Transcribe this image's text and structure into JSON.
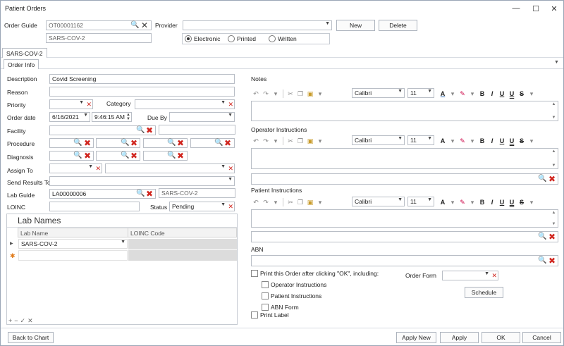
{
  "window": {
    "title": "Patient Orders"
  },
  "header": {
    "order_guide_label": "Order Guide",
    "order_guide_value": "OT00001162",
    "order_guide_name": "SARS-COV-2",
    "provider_label": "Provider",
    "provider_value": "",
    "new_label": "New",
    "delete_label": "Delete",
    "delivery": {
      "options": [
        "Electronic",
        "Printed",
        "Written"
      ],
      "selected": "Electronic"
    }
  },
  "tabs": {
    "outer": "SARS-COV-2",
    "inner": "Order Info"
  },
  "form": {
    "description_label": "Description",
    "description_value": "Covid Screening",
    "reason_label": "Reason",
    "reason_value": "",
    "priority_label": "Priority",
    "priority_value": "",
    "category_label": "Category",
    "category_value": "",
    "order_date_label": "Order date",
    "order_date_value": "6/16/2021",
    "order_time_value": "9:46:15 AM",
    "due_by_label": "Due By",
    "due_by_value": "",
    "facility_label": "Facility",
    "procedure_label": "Procedure",
    "diagnosis_label": "Diagnosis",
    "assign_to_label": "Assign To",
    "send_results_label": "Send Results To",
    "lab_guide_label": "Lab Guide",
    "lab_guide_value": "LA00000006",
    "lab_guide_name": "SARS-COV-2",
    "loinc_label": "LOINC",
    "loinc_value": "",
    "status_label": "Status",
    "status_value": "Pending"
  },
  "lab_names": {
    "title": "Lab Names",
    "columns": [
      "Lab Name",
      "LOINC Code"
    ],
    "rows": [
      {
        "lab_name": "SARS-COV-2",
        "loinc": ""
      }
    ]
  },
  "notes": {
    "notes_label": "Notes",
    "operator_label": "Operator Instructions",
    "patient_label": "Patient Instructions",
    "abn_label": "ABN",
    "font_name": "Calibri",
    "font_size": "11"
  },
  "print_options": {
    "print_order_label": "Print this Order after clicking \"OK\", including:",
    "operator_instructions": "Operator Instructions",
    "patient_instructions": "Patient Instructions",
    "abn_form": "ABN Form",
    "print_label": "Print Label",
    "order_form_label": "Order Form",
    "schedule_label": "Schedule"
  },
  "footer": {
    "back_to_chart": "Back to Chart",
    "apply_new": "Apply New",
    "apply": "Apply",
    "ok": "OK",
    "cancel": "Cancel"
  },
  "colors": {
    "accent_blue": "#2a6bb5",
    "clear_red": "#d0261f",
    "border": "#b9bec6"
  }
}
